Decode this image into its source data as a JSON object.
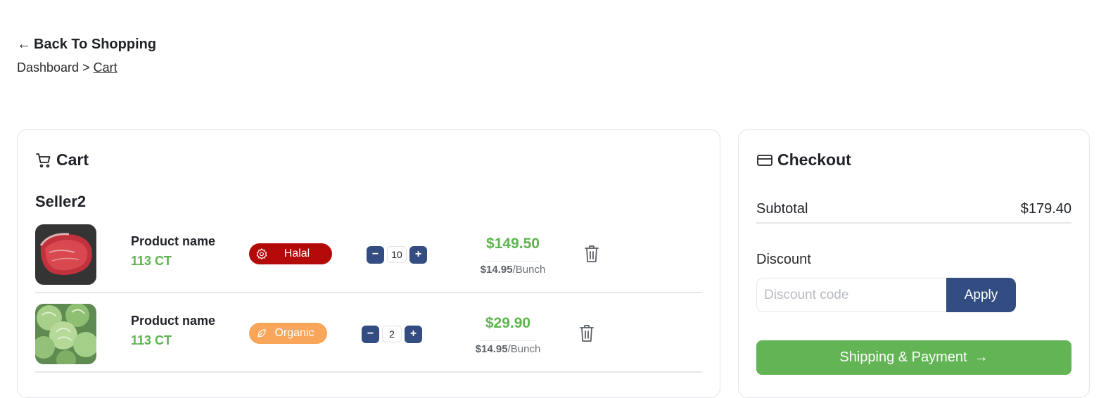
{
  "nav": {
    "back_arrow": "←",
    "back_label": "Back To Shopping",
    "breadcrumb_root": "Dashboard",
    "breadcrumb_sep": ">",
    "breadcrumb_current": "Cart"
  },
  "cart": {
    "title": "Cart",
    "icon": "cart-icon",
    "seller": "Seller2",
    "items": [
      {
        "name": "Product name",
        "sku": "113 CT",
        "badge": "Halal",
        "badge_icon": "halal-seal-icon",
        "badge_color": "#b40909",
        "quantity": "10",
        "total": "$149.50",
        "unit_price": "$14.95",
        "unit": "/Bunch",
        "minus": "−",
        "plus": "+"
      },
      {
        "name": "Product name",
        "sku": "113 CT",
        "badge": "Organic",
        "badge_icon": "leaf-icon",
        "badge_color": "#f9a65a",
        "quantity": "2",
        "total": "$29.90",
        "unit_price": "$14.95",
        "unit": "/Bunch",
        "minus": "−",
        "plus": "+"
      }
    ]
  },
  "checkout": {
    "title": "Checkout",
    "icon": "credit-card-icon",
    "subtotal_label": "Subtotal",
    "subtotal_value": "$179.40",
    "discount_label": "Discount",
    "discount_placeholder": "Discount code",
    "discount_value": "",
    "apply_label": "Apply",
    "ship_label": "Shipping & Payment",
    "ship_arrow": "→"
  },
  "colors": {
    "primary_blue": "#334d82",
    "green": "#5cb54d",
    "button_green": "#63b455"
  }
}
